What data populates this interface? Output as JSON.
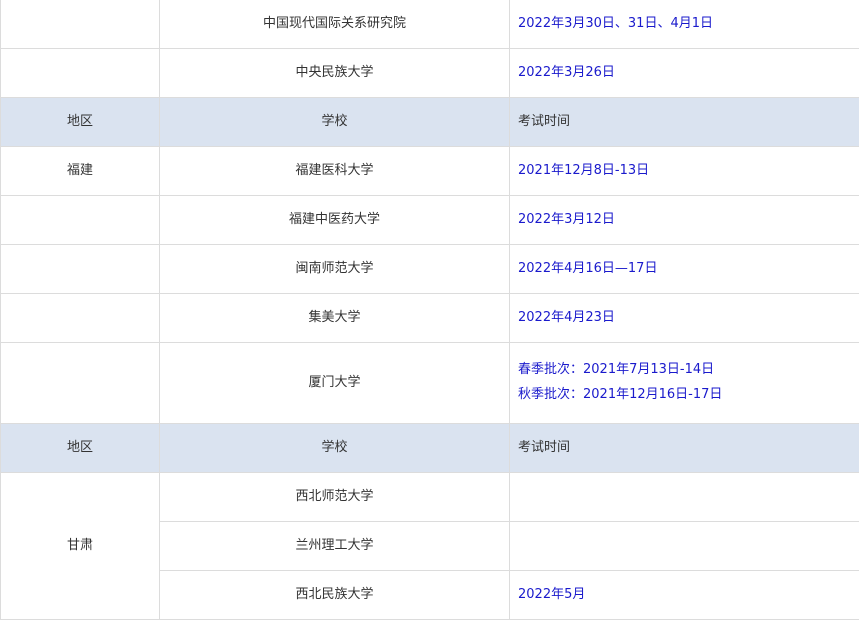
{
  "header": {
    "region": "地区",
    "school": "学校",
    "time": "考试时间"
  },
  "beijing_tail": [
    {
      "school": "中国现代国际关系研究院",
      "time": "2022年3月30日、31日、4月1日"
    },
    {
      "school": "中央民族大学",
      "time": "2022年3月26日"
    }
  ],
  "fujian": {
    "region": "福建",
    "rows": [
      {
        "school": "福建医科大学",
        "time": "2021年12月8日-13日"
      },
      {
        "school": "福建中医药大学",
        "time": "2022年3月12日"
      },
      {
        "school": "闽南师范大学",
        "time": "2022年4月16日—17日"
      },
      {
        "school": "集美大学",
        "time": "2022年4月23日"
      },
      {
        "school": "厦门大学",
        "time_lines": [
          "春季批次：2021年7月13日-14日",
          "秋季批次：2021年12月16日-17日"
        ]
      }
    ]
  },
  "gansu": {
    "region": "甘肃",
    "rows": [
      {
        "school": "西北师范大学",
        "time": ""
      },
      {
        "school": "兰州理工大学",
        "time": ""
      },
      {
        "school": "西北民族大学",
        "time": "2022年5月"
      }
    ]
  }
}
